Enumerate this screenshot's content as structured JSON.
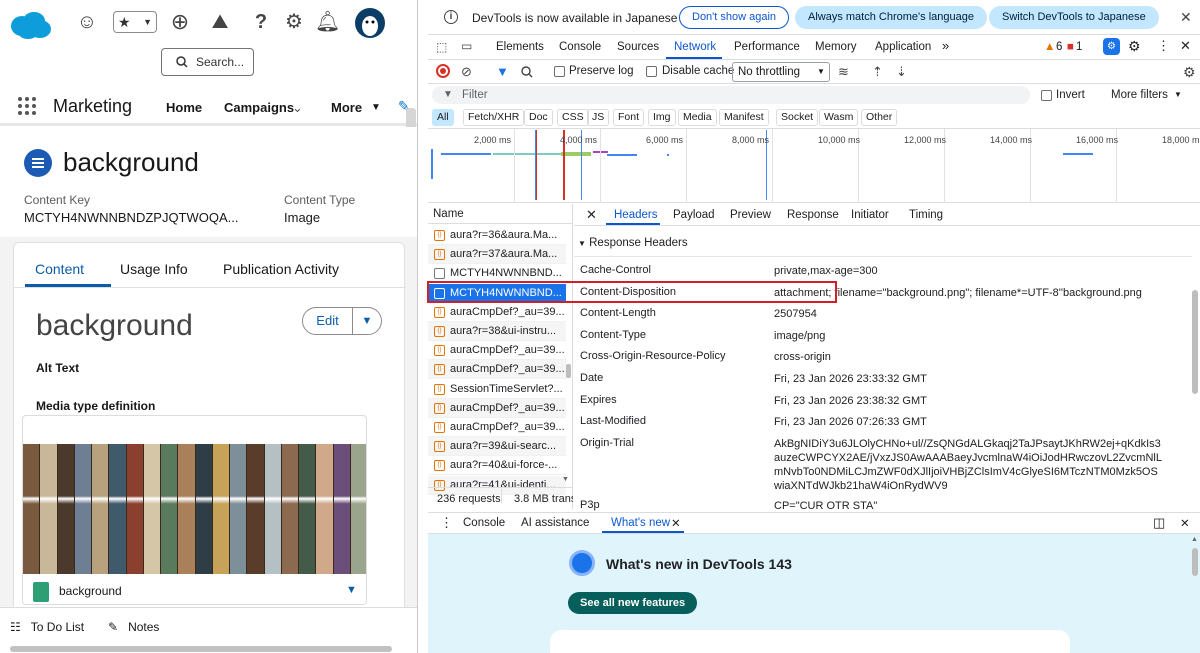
{
  "salesforce": {
    "search_label": "Search...",
    "app_name": "Marketing",
    "nav_items": [
      "Home",
      "Campaigns",
      "More"
    ],
    "record": {
      "title": "background",
      "fields": [
        {
          "label": "Content Key",
          "value": "MCTYH4NWNNBNDZPJQTWOQA..."
        },
        {
          "label": "Content Type",
          "value": "Image"
        }
      ]
    },
    "tabs": [
      "Content",
      "Usage Info",
      "Publication Activity"
    ],
    "content_title": "background",
    "edit_label": "Edit",
    "alt_text_label": "Alt Text",
    "media_label": "Media type definition",
    "file_name": "background",
    "footer": [
      "To Do List",
      "Notes"
    ],
    "plank_colors": [
      "#7a5a3e",
      "#c9b79a",
      "#4b3a2c",
      "#6e7f94",
      "#b8a27d",
      "#3f5a6b",
      "#8b3f2f",
      "#d5c6a7",
      "#597a5c",
      "#a9805a",
      "#2f3e46",
      "#c7a35a",
      "#7d8f99",
      "#5a3c2b",
      "#b4c0c4",
      "#8c6a4f",
      "#455b4a",
      "#cfa98a",
      "#6b4e7a",
      "#9aa58c"
    ]
  },
  "devtools": {
    "infobar": {
      "text": "DevTools is now available in Japanese",
      "dont_show": "Don't show again",
      "match_lang": "Always match Chrome's language",
      "switch_lang": "Switch DevTools to Japanese"
    },
    "tabs": [
      "Elements",
      "Console",
      "Sources",
      "Network",
      "Performance",
      "Memory",
      "Application"
    ],
    "warn_count": "6",
    "error_count": "1",
    "toolbar": {
      "preserve_log": "Preserve log",
      "disable_cache": "Disable cache",
      "throttling": "No throttling"
    },
    "filter_placeholder": "Filter",
    "invert_label": "Invert",
    "more_filters": "More filters",
    "type_filters": [
      "All",
      "Fetch/XHR",
      "Doc",
      "CSS",
      "JS",
      "Font",
      "Img",
      "Media",
      "Manifest",
      "Socket",
      "Wasm",
      "Other"
    ],
    "overview_ticks": [
      "2,000 ms",
      "4,000 ms",
      "6,000 ms",
      "8,000 ms",
      "10,000 ms",
      "12,000 ms",
      "14,000 ms",
      "16,000 ms",
      "18,000 ms"
    ],
    "name_header": "Name",
    "requests": [
      "aura?r=36&aura.Ma...",
      "aura?r=37&aura.Ma...",
      "MCTYH4NWNNBND...",
      "MCTYH4NWNNBND...",
      "auraCmpDef?_au=39...",
      "aura?r=38&ui-instru...",
      "auraCmpDef?_au=39...",
      "auraCmpDef?_au=39...",
      "SessionTimeServlet?...",
      "auraCmpDef?_au=39...",
      "auraCmpDef?_au=39...",
      "aura?r=39&ui-searc...",
      "aura?r=40&ui-force-...",
      "aura?r=41&ui-identi..."
    ],
    "requests_count": "236 requests",
    "transferred": "3.8 MB trans",
    "detail_tabs": [
      "Headers",
      "Payload",
      "Preview",
      "Response",
      "Initiator",
      "Timing"
    ],
    "section_title": "Response Headers",
    "headers": [
      {
        "k": "Cache-Control",
        "v": "private,max-age=300"
      },
      {
        "k": "Content-Disposition",
        "v": "attachment; filename=\"background.png\"; filename*=UTF-8''background.png"
      },
      {
        "k": "Content-Length",
        "v": "2507954"
      },
      {
        "k": "Content-Type",
        "v": "image/png"
      },
      {
        "k": "Cross-Origin-Resource-Policy",
        "v": "cross-origin"
      },
      {
        "k": "Date",
        "v": "Fri, 23 Jan 2026 23:33:32 GMT"
      },
      {
        "k": "Expires",
        "v": "Fri, 23 Jan 2026 23:38:32 GMT"
      },
      {
        "k": "Last-Modified",
        "v": "Fri, 23 Jan 2026 07:26:33 GMT"
      },
      {
        "k": "Origin-Trial",
        "v": "AkBgNIDiY3u6JLOlyCHNo+ul//ZsQNGdALGkaqj2TaJPsaytJKhRW2ej+qKdkIs3auzeCWPCYX2AE/jVxzJS0AwAAABaeyJvcmlnaW4iOiJodHRwczovL2ZvcmNlLmNvbTo0NDMiLCJmZWF0dXJlIjoiVHBjZClsImV4cGlyeSI6MTczNTM0Mzk5OSwiaXNTdWJkb21haW4iOnRydWV9"
      },
      {
        "k": "P3p",
        "v": "CP=\"CUR OTR STA\""
      }
    ],
    "drawer_tabs": [
      "Console",
      "AI assistance",
      "What's new"
    ],
    "whats_new_title": "What's new in DevTools 143",
    "see_all": "See all new features"
  }
}
